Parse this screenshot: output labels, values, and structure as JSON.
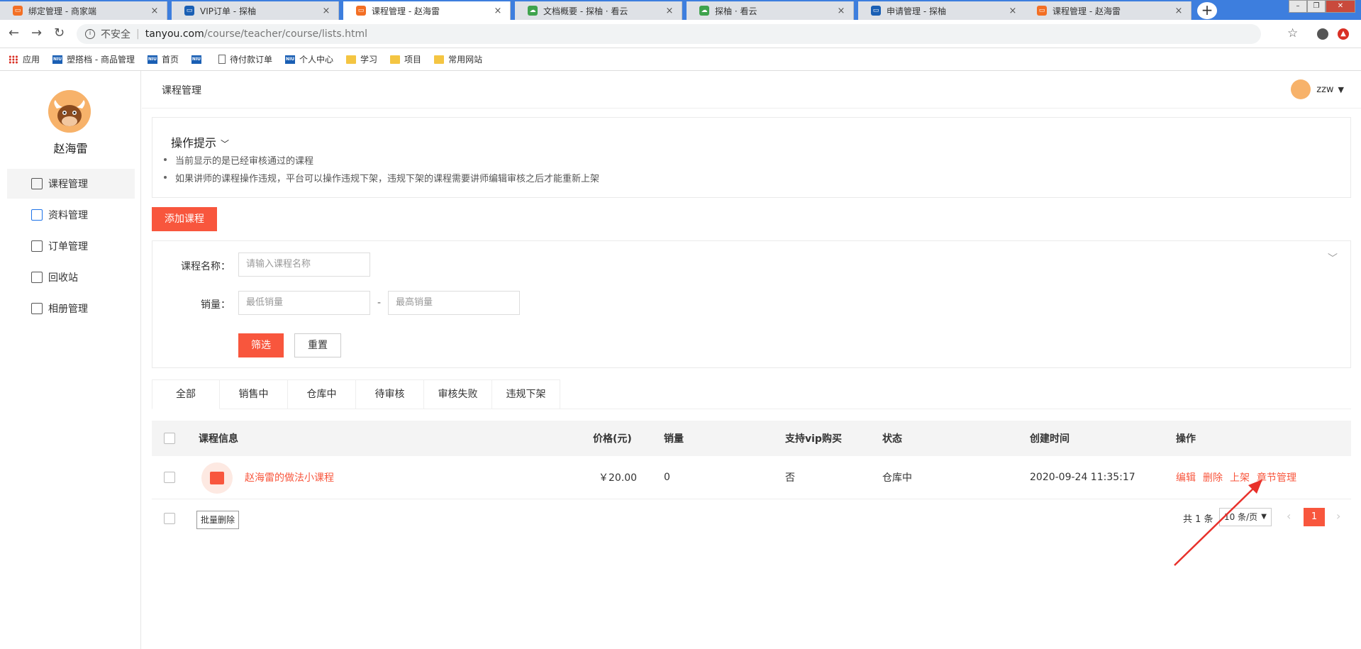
{
  "browser": {
    "tabs": [
      {
        "title": "绑定管理 - 商家端",
        "color": "#f36f24"
      },
      {
        "title": "VIP订单 - 探柚",
        "color": "#1a5fb4"
      },
      {
        "title": "课程管理 - 赵海雷",
        "color": "#f36f24"
      },
      {
        "title": "文档概要 - 探柚 · 看云",
        "color": "#3fa34d"
      },
      {
        "title": "探柚 · 看云",
        "color": "#3fa34d"
      },
      {
        "title": "申请管理 - 探柚",
        "color": "#1a5fb4"
      },
      {
        "title": "课程管理 - 赵海雷",
        "color": "#f36f24"
      }
    ],
    "active_tab": 2,
    "new_tab_label": "+",
    "close_glyph": "×",
    "url_insecure": "不安全",
    "url_host": "tanyou.com",
    "url_path": "/course/teacher/course/lists.html",
    "bookmarks": [
      {
        "label": "应用",
        "icon": "apps-grid-icon"
      },
      {
        "label": "塑搭档 - 商品管理",
        "icon": "niu-icon"
      },
      {
        "label": "首页",
        "icon": "niu-icon"
      },
      {
        "label": "",
        "icon": "niu-icon"
      },
      {
        "label": "待付款订单",
        "icon": "page-icon"
      },
      {
        "label": "个人中心",
        "icon": "niu-icon"
      },
      {
        "label": "学习",
        "icon": "folder-icon"
      },
      {
        "label": "项目",
        "icon": "folder-icon"
      },
      {
        "label": "常用网站",
        "icon": "folder-icon"
      }
    ]
  },
  "sidebar": {
    "user_name": "赵海雷",
    "items": [
      {
        "label": "课程管理",
        "icon": "gift-icon",
        "active": true
      },
      {
        "label": "资料管理",
        "icon": "bag-icon",
        "active": false
      },
      {
        "label": "订单管理",
        "icon": "document-icon",
        "active": false
      },
      {
        "label": "回收站",
        "icon": "trash-icon",
        "active": false
      },
      {
        "label": "相册管理",
        "icon": "image-icon",
        "active": false
      }
    ]
  },
  "header": {
    "breadcrumb": "课程管理",
    "user": "zzw"
  },
  "tips": {
    "title": "操作提示",
    "lines": [
      "当前显示的是已经审核通过的课程",
      "如果讲师的课程操作违规，平台可以操作违规下架，违规下架的课程需要讲师编辑审核之后才能重新上架"
    ]
  },
  "add_button": "添加课程",
  "filter": {
    "name_label": "课程名称：",
    "name_placeholder": "请输入课程名称",
    "sales_label": "销量：",
    "sales_min_placeholder": "最低销量",
    "sales_max_placeholder": "最高销量",
    "dash": "-",
    "submit": "筛选",
    "reset": "重置"
  },
  "status_tabs": [
    "全部",
    "销售中",
    "仓库中",
    "待审核",
    "审核失败",
    "违规下架"
  ],
  "table": {
    "columns": [
      "课程信息",
      "价格(元)",
      "销量",
      "支持vip购买",
      "状态",
      "创建时间",
      "操作"
    ],
    "rows": [
      {
        "name": "赵海雷的做法小课程",
        "price": "￥20.00",
        "sales": "0",
        "vip": "否",
        "status": "仓库中",
        "created": "2020-09-24 11:35:17",
        "actions": [
          "编辑",
          "删除",
          "上架",
          "章节管理"
        ]
      }
    ]
  },
  "footer": {
    "batch_delete": "批量删除",
    "total": "共 1 条",
    "page_size": "10 条/页",
    "current_page": "1"
  },
  "colors": {
    "accent": "#f8563d",
    "tabbar": "#3d7ede",
    "annotation_arrow": "#e8312b"
  }
}
